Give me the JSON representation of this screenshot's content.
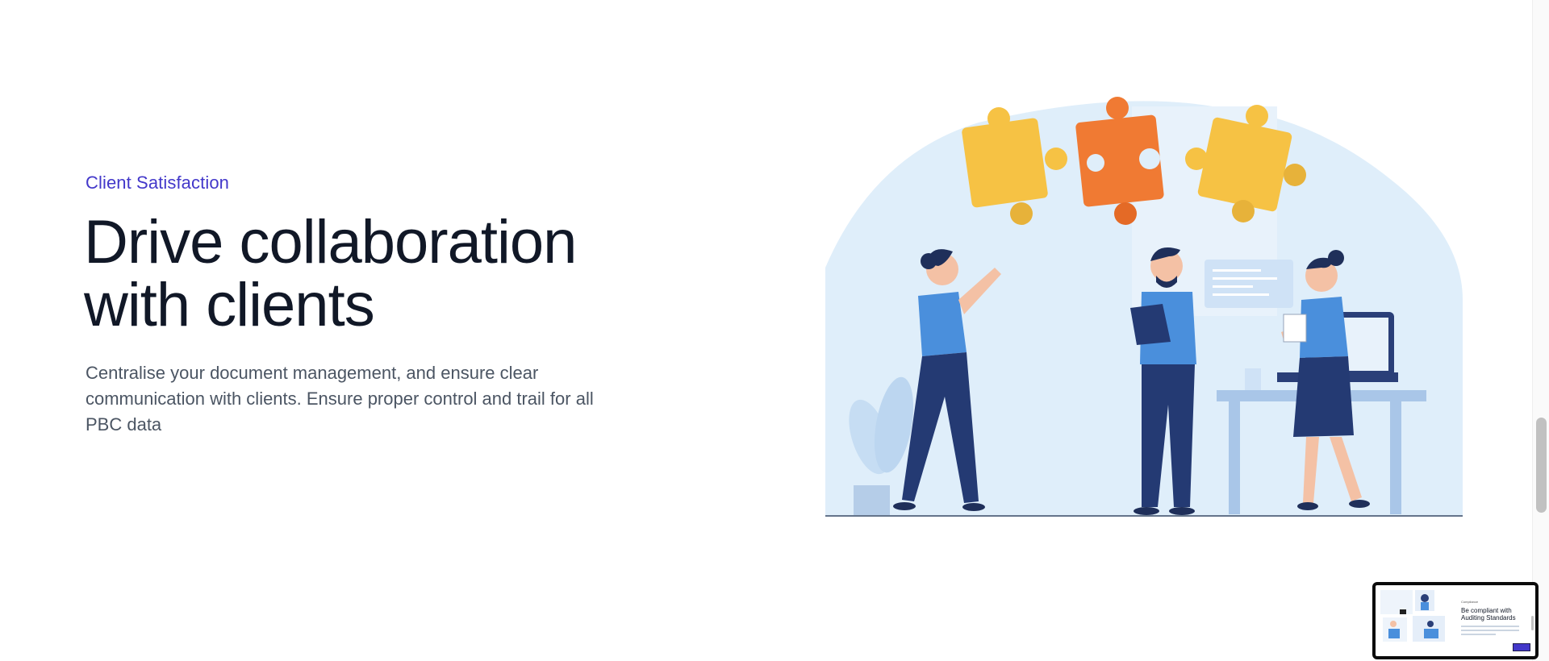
{
  "section": {
    "eyebrow": "Client Satisfaction",
    "headline": "Drive collaboration with clients",
    "body": "Centralise your document management, and ensure clear communication with clients. Ensure proper control and trail for all PBC data"
  },
  "mini_preview": {
    "eyebrow": "Compliance",
    "title": "Be compliant with Auditing Standards"
  },
  "colors": {
    "accent": "#4338ca",
    "heading": "#111827",
    "body": "#4b5563",
    "puzzle_yellow": "#f6c244",
    "puzzle_orange": "#f07a33",
    "shirt_blue": "#4a8fdc",
    "navy": "#243a73"
  }
}
